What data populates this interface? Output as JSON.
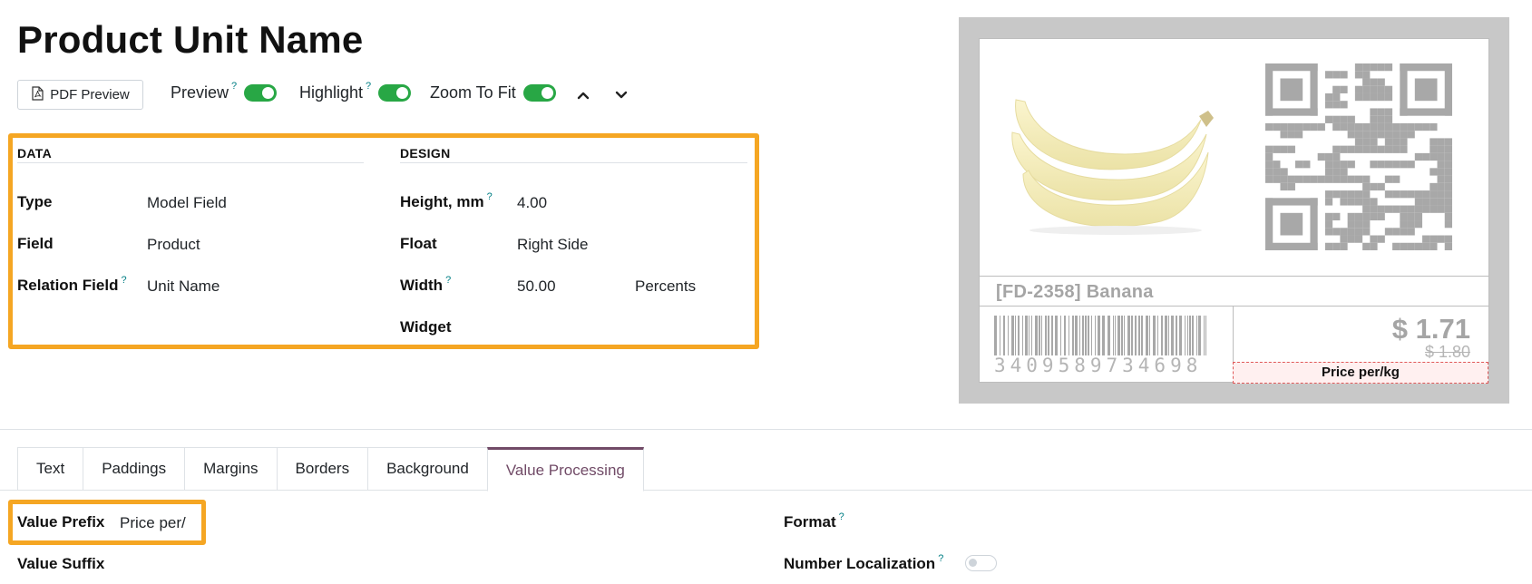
{
  "page": {
    "title": "Product Unit Name"
  },
  "toolbar": {
    "pdf_preview_label": "PDF Preview",
    "preview_label": "Preview",
    "highlight_label": "Highlight",
    "zoom_label": "Zoom To Fit",
    "help_mark": "?"
  },
  "data_section": {
    "heading": "DATA",
    "type_label": "Type",
    "type_value": "Model Field",
    "field_label": "Field",
    "field_value": "Product",
    "relation_label": "Relation Field",
    "relation_value": "Unit Name"
  },
  "design_section": {
    "heading": "DESIGN",
    "height_label": "Height, mm",
    "height_value": "4.00",
    "float_label": "Float",
    "float_value": "Right Side",
    "width_label": "Width",
    "width_value": "50.00",
    "width_unit": "Percents",
    "widget_label": "Widget"
  },
  "label_preview": {
    "product_name": "[FD-2358] Banana",
    "price": "$ 1.71",
    "old_price": "$ 1.80",
    "price_per": "Price per/kg",
    "barcode_digits": "3409589734698"
  },
  "tabs": [
    {
      "label": "Text"
    },
    {
      "label": "Paddings"
    },
    {
      "label": "Margins"
    },
    {
      "label": "Borders"
    },
    {
      "label": "Background"
    },
    {
      "label": "Value Processing"
    }
  ],
  "value_processing": {
    "prefix_label": "Value Prefix",
    "prefix_value": "Price per/",
    "suffix_label": "Value Suffix",
    "format_label": "Format",
    "localization_label": "Number Localization"
  },
  "colors": {
    "accent_highlight": "#f5a623",
    "toggle_on": "#28a745",
    "active_tab": "#714b67",
    "help_mark": "#017e84"
  }
}
